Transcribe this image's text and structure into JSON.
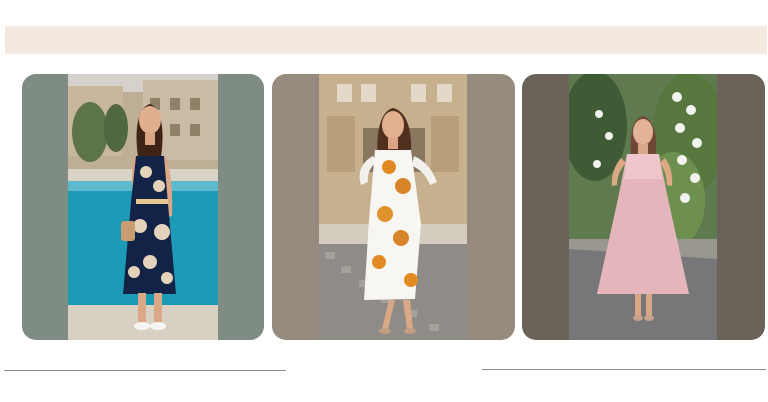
{
  "page": {
    "background_color": "#ffffff",
    "banner_color": "#f3e9de",
    "divider_color": "#8b8b8b"
  },
  "gallery": {
    "items": [
      {
        "name": "navy-floral-dress-look",
        "frame_color": "#7e8c83",
        "photo_theme": "poolside-floral-navy-dress"
      },
      {
        "name": "white-sunflower-dress-look",
        "frame_color": "#978a7e",
        "photo_theme": "street-white-floral-dress"
      },
      {
        "name": "pink-maxi-dress-look",
        "frame_color": "#6b6258",
        "photo_theme": "garden-pink-dress"
      }
    ]
  }
}
